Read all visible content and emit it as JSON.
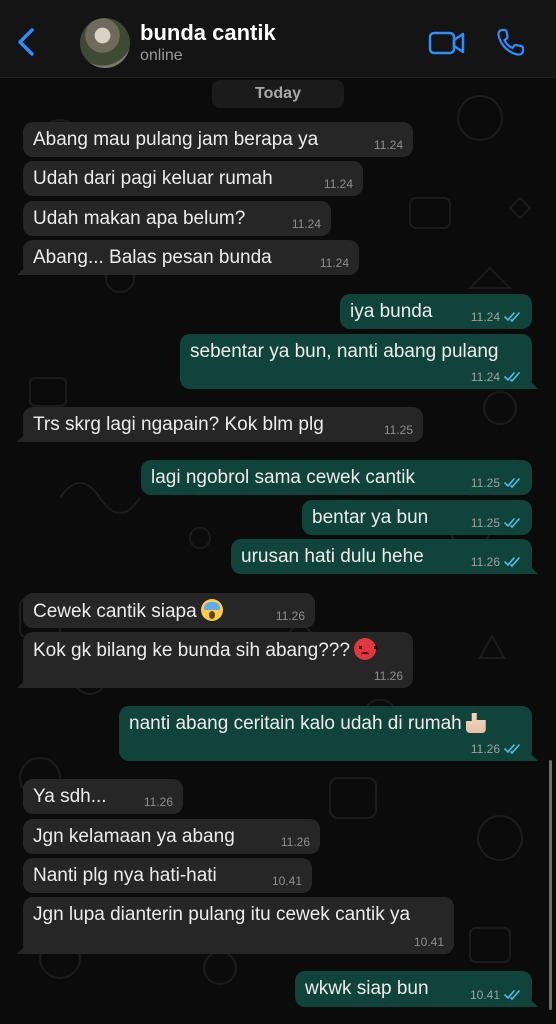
{
  "header": {
    "contact_name": "bunda cantik",
    "status": "online",
    "accent_color": "#2f8dff"
  },
  "date_divider": "Today",
  "messages": [
    {
      "direction": "in",
      "text": "Abang mau pulang jam berapa ya",
      "time": "11.24"
    },
    {
      "direction": "in",
      "text": "Udah dari pagi keluar rumah",
      "time": "11.24"
    },
    {
      "direction": "in",
      "text": "Udah makan apa belum?",
      "time": "11.24"
    },
    {
      "direction": "in",
      "text": "Abang... Balas pesan bunda",
      "time": "11.24"
    },
    {
      "direction": "out",
      "text": "iya bunda",
      "time": "11.24",
      "read": true
    },
    {
      "direction": "out",
      "text": "sebentar ya bun, nanti abang pulang",
      "time": "11.24",
      "read": true
    },
    {
      "direction": "in",
      "text": "Trs skrg lagi ngapain? Kok blm plg",
      "time": "11.25"
    },
    {
      "direction": "out",
      "text": "lagi ngobrol sama cewek cantik",
      "time": "11.25",
      "read": true
    },
    {
      "direction": "out",
      "text": "bentar ya bun",
      "time": "11.25",
      "read": true
    },
    {
      "direction": "out",
      "text": "urusan hati dulu hehe",
      "time": "11.26",
      "read": true
    },
    {
      "direction": "in",
      "text": "Cewek cantik siapa",
      "emoji": "face-screaming-in-fear-emoji",
      "time": "11.26"
    },
    {
      "direction": "in",
      "text": "Kok gk bilang ke bunda sih abang???",
      "emoji": "angry-face-emoji",
      "time": "11.26"
    },
    {
      "direction": "out",
      "text": "nanti abang ceritain kalo udah di rumah",
      "emoji": "thumbs-up-emoji",
      "time": "11.26",
      "read": true
    },
    {
      "direction": "in",
      "text": "Ya sdh...",
      "time": "11.26"
    },
    {
      "direction": "in",
      "text": "Jgn kelamaan ya abang",
      "time": "11.26"
    },
    {
      "direction": "in",
      "text": "Nanti plg nya hati-hati",
      "time": "10.41"
    },
    {
      "direction": "in",
      "text": "Jgn lupa dianterin pulang itu cewek cantik ya",
      "time": "10.41"
    },
    {
      "direction": "out",
      "text": "wkwk siap bun",
      "time": "10.41",
      "read": true
    }
  ],
  "colors": {
    "incoming_bubble": "#262626",
    "outgoing_bubble": "#10443a",
    "read_ticks": "#53bdeb",
    "background": "#0b0b0b"
  }
}
